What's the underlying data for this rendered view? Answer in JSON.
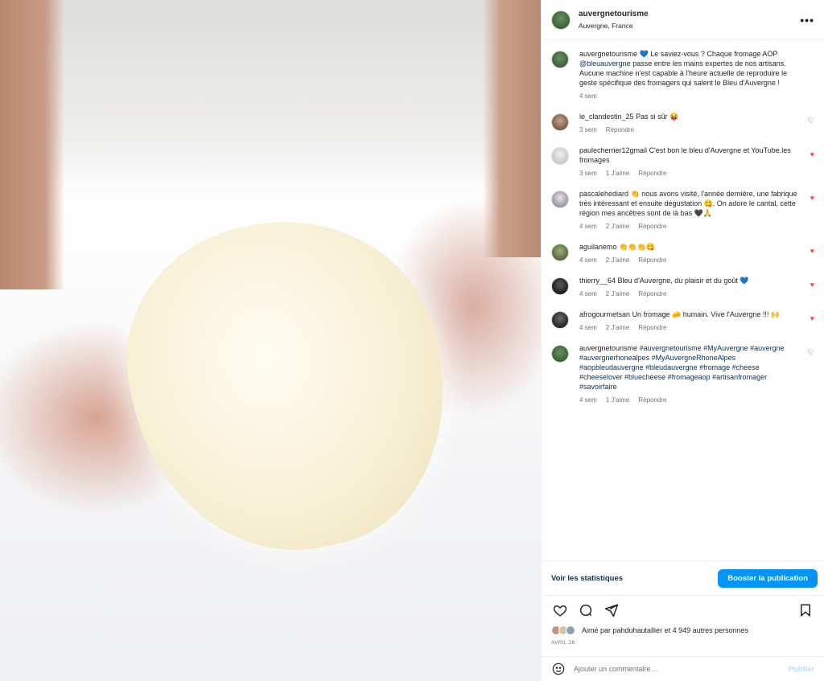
{
  "post": {
    "username": "auvergnetourisme",
    "location": "Auvergne, France",
    "more_label": "•••"
  },
  "caption": {
    "username": "auvergnetourisme",
    "emoji": "💙",
    "text_before_tag": "Le saviez-vous ? Chaque fromage AOP",
    "tag": "@bleuauvergne",
    "text_after_tag": "passe entre les mains expertes de nos artisans. Aucune machine n'est capable à l'heure actuelle de reproduire le geste spécifique des fromagers qui salent le Bleu d'Auvergne !",
    "time": "4 sem"
  },
  "comments": [
    {
      "user": "le_clandestin_25",
      "text": "Pas si sûr 😝",
      "time": "3 sem",
      "likes": "",
      "reply": "Répondre",
      "liked": false
    },
    {
      "user": "paulecherrier12gmail",
      "text": "C'est bon le bleu d'Auvergne et YouTube.les fromages",
      "time": "3 sem",
      "likes": "1 J'aime",
      "reply": "Répondre",
      "liked": true
    },
    {
      "user": "pascalehediard",
      "text": "👏 nous avons visité, l'année dernière, une fabrique très intéressant et ensuite dégustation 😋. On adore le cantal, cette région mes ancêtres sont de là bas 🖤🙏",
      "time": "4 sem",
      "likes": "2 J'aime",
      "reply": "Répondre",
      "liked": true
    },
    {
      "user": "aguilanemo",
      "text": "👏👏👏😋",
      "time": "4 sem",
      "likes": "2 J'aime",
      "reply": "Répondre",
      "liked": true
    },
    {
      "user": "thierry__64",
      "text": "Bleu d'Auvergne, du plaisir et du goût 💙",
      "time": "4 sem",
      "likes": "2 J'aime",
      "reply": "Répondre",
      "liked": true
    },
    {
      "user": "afrogourmetsan",
      "text": "Un fromage 🧀 humain. Vive l'Auvergne !!! 🙌",
      "time": "4 sem",
      "likes": "2 J'aime",
      "reply": "Répondre",
      "liked": true
    },
    {
      "user": "auvergnetourisme",
      "text": "",
      "time": "4 sem",
      "likes": "1 J'aime",
      "reply": "Répondre",
      "liked": false
    }
  ],
  "hashtags": "#auvergnetourisme #MyAuvergne #auvergne #auvergnerhonealpes #MyAuvergneRhoneAlpes #aopbleudauvergne #bleudauvergne #fromage #cheese #cheeselover #bluecheese #fromageaop #artisanfromager #savoirfaire",
  "stats": {
    "link": "Voir les statistiques",
    "boost": "Booster la publication"
  },
  "likes": {
    "text": "Aimé par pahduhautallier et 4 949 autres personnes",
    "date": "AVRIL 26"
  },
  "add_comment": {
    "placeholder": "Ajouter un commentaire…",
    "publish": "Publier"
  },
  "icons": {
    "heart": "heart-icon",
    "comment": "comment-icon",
    "share": "share-icon",
    "bookmark": "bookmark-icon",
    "emoji": "emoji-icon"
  },
  "colors": {
    "accent": "#0095f6",
    "link": "#00376b",
    "like": "#ed4956"
  }
}
